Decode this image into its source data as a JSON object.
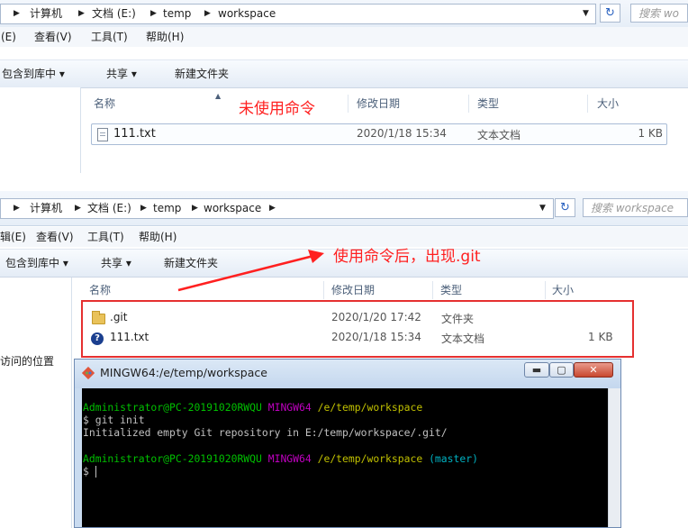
{
  "explorer_top": {
    "breadcrumb": [
      "计算机",
      "文档 (E:)",
      "temp",
      "workspace"
    ],
    "search_placeholder": "搜索 wo",
    "menu": [
      "(E)",
      "查看(V)",
      "工具(T)",
      "帮助(H)"
    ],
    "toolbar": [
      "包含到库中 ▾",
      "共享 ▾",
      "新建文件夹"
    ],
    "columns": [
      "名称",
      "修改日期",
      "类型",
      "大小"
    ],
    "rows": [
      {
        "name": "111.txt",
        "date": "2020/1/18 15:34",
        "type": "文本文档",
        "size": "1 KB"
      }
    ],
    "annotation": "未使用命令"
  },
  "explorer_bottom": {
    "breadcrumb": [
      "计算机",
      "文档 (E:)",
      "temp",
      "workspace"
    ],
    "search_placeholder": "搜索 workspace",
    "menu": [
      "辑(E)",
      "查看(V)",
      "工具(T)",
      "帮助(H)"
    ],
    "toolbar": [
      "包含到库中 ▾",
      "共享 ▾",
      "新建文件夹"
    ],
    "columns": [
      "名称",
      "修改日期",
      "类型",
      "大小"
    ],
    "rows": [
      {
        "name": ".git",
        "date": "2020/1/20 17:42",
        "type": "文件夹",
        "size": ""
      },
      {
        "name": "111.txt",
        "date": "2020/1/18 15:34",
        "type": "文本文档",
        "size": "1 KB"
      }
    ],
    "nav_partial": "访问的位置",
    "annotation": "使用命令后，出现.git"
  },
  "terminal": {
    "title": "MINGW64:/e/temp/workspace",
    "buttons": [
      "▬",
      "▢",
      "✕"
    ],
    "lines": [
      {
        "user": "Administrator@PC-20191020RWQU",
        "env": "MINGW64",
        "path": "/e/temp/workspace",
        "branch": ""
      },
      {
        "text": "$ git init"
      },
      {
        "text": "Initialized empty Git repository in E:/temp/workspace/.git/"
      },
      {
        "user": "Administrator@PC-20191020RWQU",
        "env": "MINGW64",
        "path": "/e/temp/workspace",
        "branch": "(master)"
      },
      {
        "text": "$ "
      }
    ],
    "colors": {
      "user": "#00c000",
      "env": "#c000c0",
      "path": "#c0c000",
      "branch": "#00b0c0",
      "text": "#c0c0c0"
    }
  },
  "colors": {
    "annotation": "#ff2020",
    "highlight_box": "#e53030"
  }
}
